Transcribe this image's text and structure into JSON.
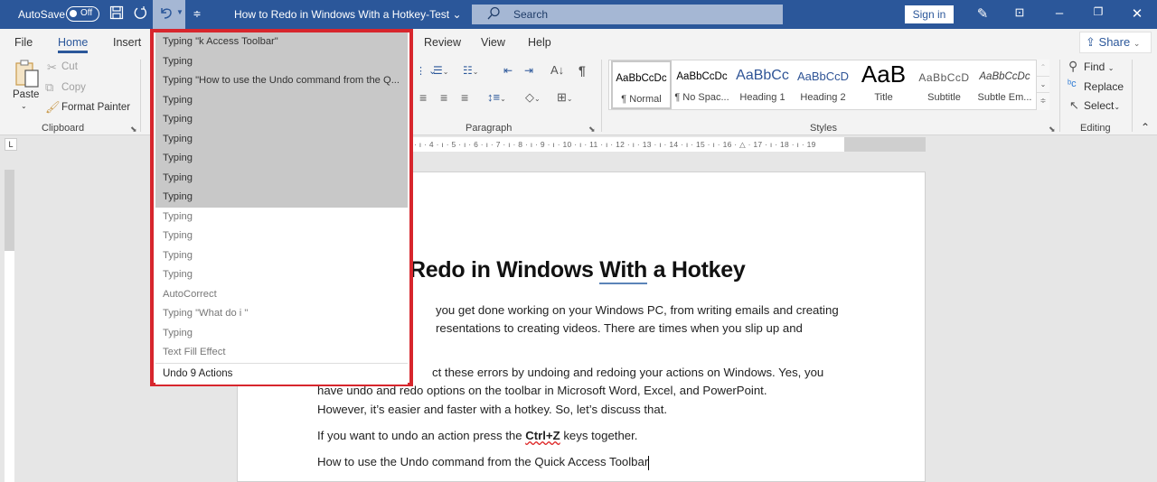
{
  "titlebar": {
    "autosave_label": "AutoSave",
    "autosave_state": "Off",
    "document_title": "How to Redo in Windows With a Hotkey-Test",
    "search_placeholder": "Search",
    "sign_in": "Sign in",
    "icons": [
      "save-icon",
      "redo-icon",
      "undo-icon",
      "customize-qat-icon",
      "pen-icon",
      "ribbon-display-icon",
      "minimize-icon",
      "restore-icon",
      "close-icon"
    ],
    "accent_color": "#2b579a"
  },
  "tabs": [
    {
      "label": "File"
    },
    {
      "label": "Home",
      "active": true
    },
    {
      "label": "Insert"
    },
    {
      "label": "Review"
    },
    {
      "label": "View"
    },
    {
      "label": "Help"
    }
  ],
  "share_label": "Share",
  "ribbon": {
    "clipboard": {
      "label": "Clipboard",
      "paste": "Paste",
      "cut": "Cut",
      "copy": "Copy",
      "format_painter": "Format Painter"
    },
    "paragraph": {
      "label": "Paragraph"
    },
    "styles": {
      "label": "Styles",
      "items": [
        {
          "preview": "AaBbCcDc",
          "name": "¶ Normal",
          "selected": true
        },
        {
          "preview": "AaBbCcDc",
          "name": "¶ No Spac..."
        },
        {
          "preview": "AaBbCc",
          "name": "Heading 1"
        },
        {
          "preview": "AaBbCcD",
          "name": "Heading 2"
        },
        {
          "preview": "AaB",
          "name": "Title"
        },
        {
          "preview": "AaBbCcD",
          "name": "Subtitle"
        },
        {
          "preview": "AaBbCcDc",
          "name": "Subtle Em..."
        }
      ]
    },
    "editing": {
      "label": "Editing",
      "find": "Find",
      "replace": "Replace",
      "select": "Select"
    }
  },
  "ruler": {
    "horizontal_text": "· ı · 4 · ı · 5 · ı · 6 · ı · 7 · ı · 8 · ı · 9 · ı · 10 · ı · 11 · ı · 12 · ı · 13 · ı · 14 · ı · 15 · ı · 16 · △ · 17 · ı · 18 · ı · 19"
  },
  "undo_menu": {
    "items": [
      {
        "label": "Typing \"k Access Toolbar\"",
        "selected": true
      },
      {
        "label": "Typing",
        "selected": true
      },
      {
        "label": "Typing \"How to use the Undo command from the Q...",
        "selected": true
      },
      {
        "label": "Typing",
        "selected": true
      },
      {
        "label": "Typing",
        "selected": true
      },
      {
        "label": "Typing",
        "selected": true
      },
      {
        "label": "Typing",
        "selected": true
      },
      {
        "label": "Typing",
        "selected": true
      },
      {
        "label": "Typing",
        "selected": true
      },
      {
        "label": "Typing",
        "selected": false
      },
      {
        "label": "Typing",
        "selected": false
      },
      {
        "label": "Typing",
        "selected": false
      },
      {
        "label": "Typing",
        "selected": false
      },
      {
        "label": "AutoCorrect",
        "selected": false
      },
      {
        "label": "Typing \"What do i \"",
        "selected": false
      },
      {
        "label": "Typing",
        "selected": false
      },
      {
        "label": "Text Fill Effect",
        "selected": false
      }
    ],
    "footer": "Undo 9 Actions",
    "highlight_border_color": "#d7262d"
  },
  "document": {
    "heading_pre": "Redo in Windows ",
    "heading_underlined": "With",
    "heading_post": " a Hotkey",
    "para1_line1": "you get done working on your Windows PC, from writing emails and creating",
    "para1_line2": "resentations to creating videos.  There are times when you slip up and",
    "para2_line1": "ct these errors by undoing and redoing your actions on Windows. Yes, you",
    "para2_line2": "have undo and redo options on the toolbar in Microsoft Word, Excel, and PowerPoint.",
    "para2_line3": "However, it’s easier and faster with a hotkey. So, let’s discuss that.",
    "para3_pre": "If you want to undo an action press the ",
    "para3_bold": "Ctrl+Z",
    "para3_post": " keys together.",
    "para4": "How to use the Undo command from the Quick Access Toolbar"
  }
}
